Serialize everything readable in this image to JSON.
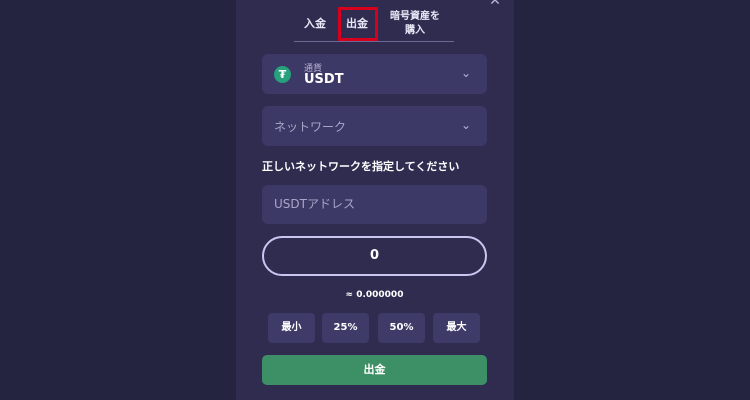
{
  "tabs": {
    "deposit": "入金",
    "withdraw": "出金",
    "buy_line1": "暗号資産を",
    "buy_line2": "購入"
  },
  "currency": {
    "label": "通貨",
    "value": "USDT",
    "icon": "tether-icon"
  },
  "network": {
    "placeholder": "ネットワーク"
  },
  "instruction": "正しいネットワークを指定してください",
  "address": {
    "placeholder": "USDTアドレス"
  },
  "amount": {
    "value": "0",
    "approx": "≈ 0.000000"
  },
  "percent_buttons": {
    "min": "最小",
    "p25": "25%",
    "p50": "50%",
    "max": "最大"
  },
  "withdraw_button": "出金",
  "colors": {
    "highlight": "#d6001c",
    "primary_button": "#3d8f66",
    "background": "#252440",
    "panel": "#2f2c50"
  }
}
